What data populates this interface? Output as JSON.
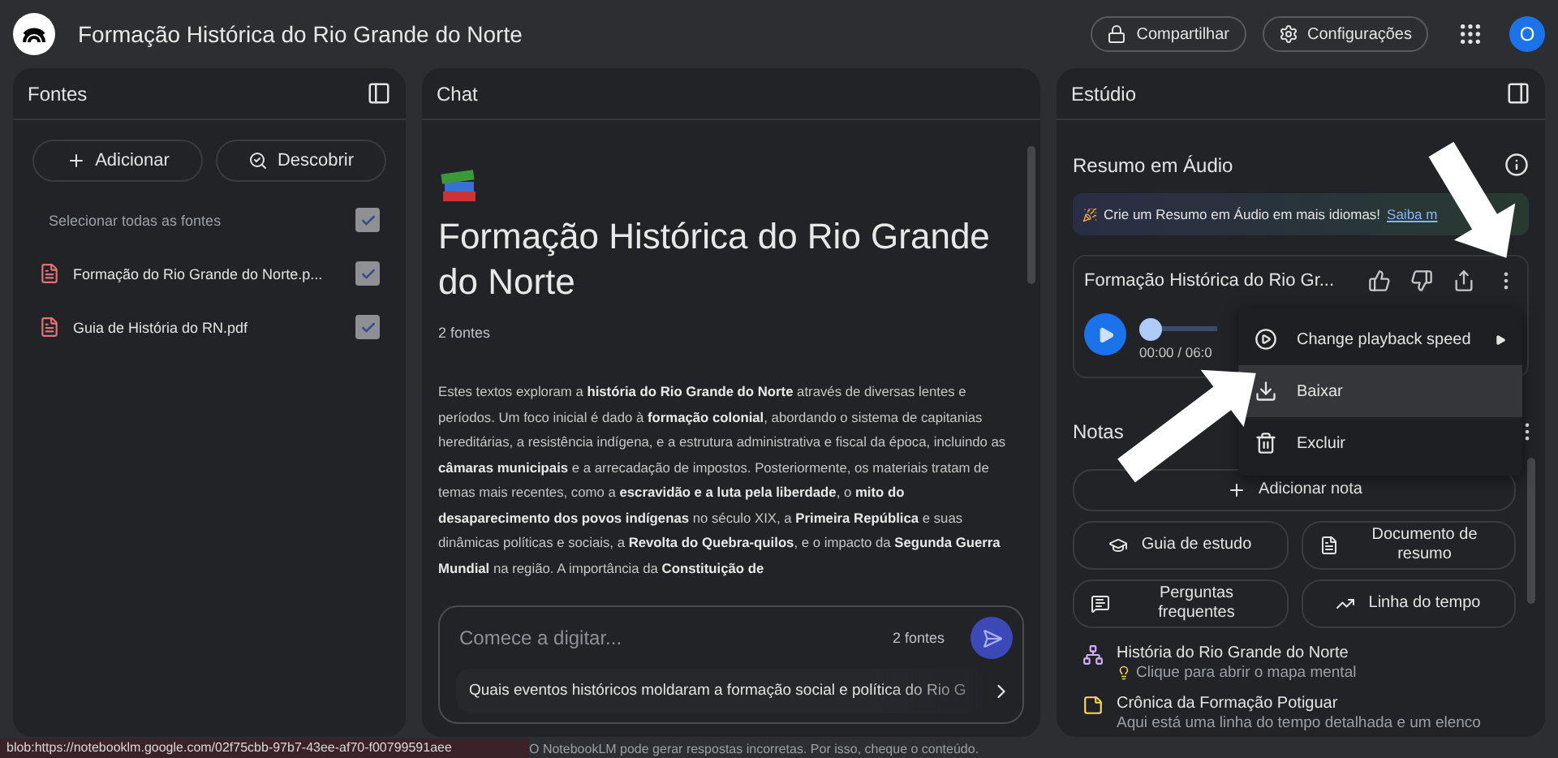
{
  "app": {
    "title": "Formação Histórica do Rio Grande do Norte",
    "avatar_letter": "O"
  },
  "header_buttons": [
    {
      "kind": "share",
      "label": "Compartilhar"
    },
    {
      "kind": "settings",
      "label": "Configurações"
    }
  ],
  "sources": {
    "title": "Fontes",
    "actions": [
      {
        "kind": "add",
        "label": "Adicionar"
      },
      {
        "kind": "discover",
        "label": "Descobrir"
      }
    ],
    "select_all": {
      "label": "Selecionar todas as fontes",
      "checked": true
    },
    "items": [
      {
        "name": "Formação do Rio Grande do Norte.p...",
        "checked": true
      },
      {
        "name": "Guia de História do RN.pdf",
        "checked": true
      }
    ]
  },
  "chat": {
    "title": "Chat",
    "heading": "Formação Histórica do Rio Grande do Norte",
    "source_count": "2 fontes",
    "summary": "Estes textos exploram a **história do Rio Grande do Norte** através de diversas lentes e períodos. Um foco inicial é dado à **formação colonial**, abordando o sistema de capitanias hereditárias, a resistência indígena, e a estrutura administrativa e fiscal da época, incluindo as **câmaras municipais** e a arrecadação de impostos. Posteriormente, os materiais tratam de temas mais recentes, como a **escravidão e a luta pela liberdade**, o **mito do desaparecimento dos povos indígenas** no século XIX, a **Primeira República** e suas dinâmicas políticas e sociais, a **Revolta do Quebra-quilos**, e o impacto da **Segunda Guerra Mundial** na região. A importância da **Constituição de**",
    "input": {
      "placeholder": "Comece a digitar...",
      "source_count": "2 fontes"
    },
    "suggestion": "Quais eventos históricos moldaram a formação social e política do Rio G"
  },
  "studio": {
    "title": "Estúdio",
    "audio_title": "Resumo em Áudio",
    "banner": {
      "text": "Crie um Resumo em Áudio em mais idiomas!",
      "link": "Saiba m"
    },
    "player": {
      "title": "Formação Histórica do Rio Gr...",
      "time": "00:00 / 06:0",
      "level": 0
    },
    "menu": [
      {
        "kind": "speed",
        "label": "Change playback speed",
        "selected": false
      },
      {
        "kind": "download",
        "label": "Baixar",
        "selected": true
      },
      {
        "kind": "delete",
        "label": "Excluir",
        "selected": false
      }
    ],
    "notes_title": "Notas",
    "add_note": "Adicionar nota",
    "tools": [
      {
        "kind": "guide",
        "label": "Guia de estudo"
      },
      {
        "kind": "doc",
        "label": "Documento de resumo"
      },
      {
        "kind": "faq",
        "label": "Perguntas frequentes"
      },
      {
        "kind": "timeline",
        "label": "Linha do tempo"
      }
    ],
    "notes": [
      {
        "kind": "mindmap",
        "title": "História do Rio Grande do Norte",
        "subtitle": "Clique para abrir o mapa mental"
      },
      {
        "kind": "note",
        "title": "Crônica da Formação Potiguar",
        "subtitle": "Aqui está uma linha do tempo detalhada e um elenco"
      }
    ]
  },
  "status": {
    "url": "blob:https://notebooklm.google.com/02f75cbb-97b7-43ee-af70-f00799591aee",
    "disclaimer": "O NotebookLM pode gerar respostas incorretas. Por isso, cheque o conteúdo."
  }
}
